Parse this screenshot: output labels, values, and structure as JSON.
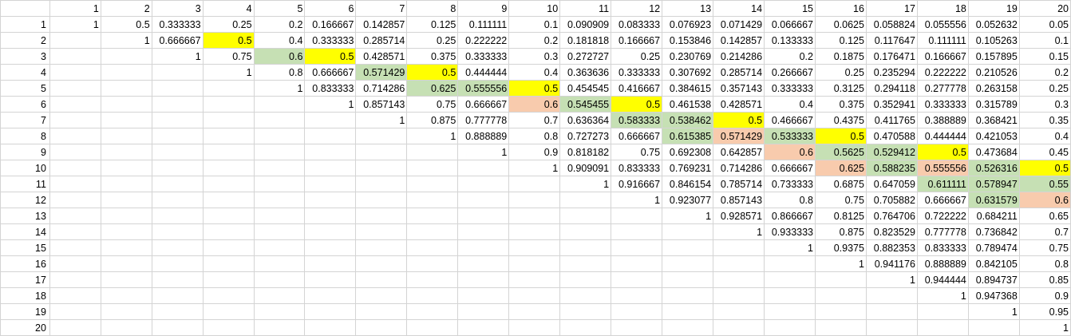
{
  "colors": {
    "yellow": "#ffff00",
    "green": "#c6e0b4",
    "orange": "#f8cbad",
    "grid": "#d4d4d4"
  },
  "column_headers": [
    "1",
    "2",
    "3",
    "4",
    "5",
    "6",
    "7",
    "8",
    "9",
    "10",
    "11",
    "12",
    "13",
    "14",
    "15",
    "16",
    "17",
    "18",
    "19",
    "20"
  ],
  "rows": [
    {
      "header": "1",
      "cells": [
        "1",
        "0.5",
        "0.333333",
        "0.25",
        "0.2",
        "0.166667",
        "0.142857",
        "0.125",
        "0.111111",
        "0.1",
        "0.090909",
        "0.083333",
        "0.076923",
        "0.071429",
        "0.066667",
        "0.0625",
        "0.058824",
        "0.055556",
        "0.052632",
        "0.05"
      ],
      "fills": [
        "",
        "",
        "",
        "",
        "",
        "",
        "",
        "",
        "",
        "",
        "",
        "",
        "",
        "",
        "",
        "",
        "",
        "",
        "",
        ""
      ]
    },
    {
      "header": "2",
      "cells": [
        "",
        "1",
        "0.666667",
        "0.5",
        "0.4",
        "0.333333",
        "0.285714",
        "0.25",
        "0.222222",
        "0.2",
        "0.181818",
        "0.166667",
        "0.153846",
        "0.142857",
        "0.133333",
        "0.125",
        "0.117647",
        "0.111111",
        "0.105263",
        "0.1"
      ],
      "fills": [
        "",
        "",
        "",
        "yellow",
        "",
        "",
        "",
        "",
        "",
        "",
        "",
        "",
        "",
        "",
        "",
        "",
        "",
        "",
        "",
        ""
      ]
    },
    {
      "header": "3",
      "cells": [
        "",
        "",
        "1",
        "0.75",
        "0.6",
        "0.5",
        "0.428571",
        "0.375",
        "0.333333",
        "0.3",
        "0.272727",
        "0.25",
        "0.230769",
        "0.214286",
        "0.2",
        "0.1875",
        "0.176471",
        "0.166667",
        "0.157895",
        "0.15"
      ],
      "fills": [
        "",
        "",
        "",
        "",
        "green",
        "yellow",
        "",
        "",
        "",
        "",
        "",
        "",
        "",
        "",
        "",
        "",
        "",
        "",
        "",
        ""
      ]
    },
    {
      "header": "4",
      "cells": [
        "",
        "",
        "",
        "1",
        "0.8",
        "0.666667",
        "0.571429",
        "0.5",
        "0.444444",
        "0.4",
        "0.363636",
        "0.333333",
        "0.307692",
        "0.285714",
        "0.266667",
        "0.25",
        "0.235294",
        "0.222222",
        "0.210526",
        "0.2"
      ],
      "fills": [
        "",
        "",
        "",
        "",
        "",
        "",
        "green",
        "yellow",
        "",
        "",
        "",
        "",
        "",
        "",
        "",
        "",
        "",
        "",
        "",
        ""
      ]
    },
    {
      "header": "5",
      "cells": [
        "",
        "",
        "",
        "",
        "1",
        "0.833333",
        "0.714286",
        "0.625",
        "0.555556",
        "0.5",
        "0.454545",
        "0.416667",
        "0.384615",
        "0.357143",
        "0.333333",
        "0.3125",
        "0.294118",
        "0.277778",
        "0.263158",
        "0.25"
      ],
      "fills": [
        "",
        "",
        "",
        "",
        "",
        "",
        "",
        "green",
        "green",
        "yellow",
        "",
        "",
        "",
        "",
        "",
        "",
        "",
        "",
        "",
        ""
      ]
    },
    {
      "header": "6",
      "cells": [
        "",
        "",
        "",
        "",
        "",
        "1",
        "0.857143",
        "0.75",
        "0.666667",
        "0.6",
        "0.545455",
        "0.5",
        "0.461538",
        "0.428571",
        "0.4",
        "0.375",
        "0.352941",
        "0.333333",
        "0.315789",
        "0.3"
      ],
      "fills": [
        "",
        "",
        "",
        "",
        "",
        "",
        "",
        "",
        "",
        "orange",
        "green",
        "yellow",
        "",
        "",
        "",
        "",
        "",
        "",
        "",
        ""
      ]
    },
    {
      "header": "7",
      "cells": [
        "",
        "",
        "",
        "",
        "",
        "",
        "1",
        "0.875",
        "0.777778",
        "0.7",
        "0.636364",
        "0.583333",
        "0.538462",
        "0.5",
        "0.466667",
        "0.4375",
        "0.411765",
        "0.388889",
        "0.368421",
        "0.35"
      ],
      "fills": [
        "",
        "",
        "",
        "",
        "",
        "",
        "",
        "",
        "",
        "",
        "",
        "green",
        "green",
        "yellow",
        "",
        "",
        "",
        "",
        "",
        ""
      ]
    },
    {
      "header": "8",
      "cells": [
        "",
        "",
        "",
        "",
        "",
        "",
        "",
        "1",
        "0.888889",
        "0.8",
        "0.727273",
        "0.666667",
        "0.615385",
        "0.571429",
        "0.533333",
        "0.5",
        "0.470588",
        "0.444444",
        "0.421053",
        "0.4"
      ],
      "fills": [
        "",
        "",
        "",
        "",
        "",
        "",
        "",
        "",
        "",
        "",
        "",
        "",
        "green",
        "orange",
        "green",
        "yellow",
        "",
        "",
        "",
        ""
      ]
    },
    {
      "header": "9",
      "cells": [
        "",
        "",
        "",
        "",
        "",
        "",
        "",
        "",
        "1",
        "0.9",
        "0.818182",
        "0.75",
        "0.692308",
        "0.642857",
        "0.6",
        "0.5625",
        "0.529412",
        "0.5",
        "0.473684",
        "0.45"
      ],
      "fills": [
        "",
        "",
        "",
        "",
        "",
        "",
        "",
        "",
        "",
        "",
        "",
        "",
        "",
        "",
        "orange",
        "green",
        "green",
        "yellow",
        "",
        ""
      ]
    },
    {
      "header": "10",
      "cells": [
        "",
        "",
        "",
        "",
        "",
        "",
        "",
        "",
        "",
        "1",
        "0.909091",
        "0.833333",
        "0.769231",
        "0.714286",
        "0.666667",
        "0.625",
        "0.588235",
        "0.555556",
        "0.526316",
        "0.5"
      ],
      "fills": [
        "",
        "",
        "",
        "",
        "",
        "",
        "",
        "",
        "",
        "",
        "",
        "",
        "",
        "",
        "",
        "orange",
        "green",
        "orange",
        "green",
        "yellow"
      ]
    },
    {
      "header": "11",
      "cells": [
        "",
        "",
        "",
        "",
        "",
        "",
        "",
        "",
        "",
        "",
        "1",
        "0.916667",
        "0.846154",
        "0.785714",
        "0.733333",
        "0.6875",
        "0.647059",
        "0.611111",
        "0.578947",
        "0.55"
      ],
      "fills": [
        "",
        "",
        "",
        "",
        "",
        "",
        "",
        "",
        "",
        "",
        "",
        "",
        "",
        "",
        "",
        "",
        "",
        "green",
        "green",
        "green"
      ]
    },
    {
      "header": "12",
      "cells": [
        "",
        "",
        "",
        "",
        "",
        "",
        "",
        "",
        "",
        "",
        "",
        "1",
        "0.923077",
        "0.857143",
        "0.8",
        "0.75",
        "0.705882",
        "0.666667",
        "0.631579",
        "0.6"
      ],
      "fills": [
        "",
        "",
        "",
        "",
        "",
        "",
        "",
        "",
        "",
        "",
        "",
        "",
        "",
        "",
        "",
        "",
        "",
        "",
        "green",
        "orange"
      ]
    },
    {
      "header": "13",
      "cells": [
        "",
        "",
        "",
        "",
        "",
        "",
        "",
        "",
        "",
        "",
        "",
        "",
        "1",
        "0.928571",
        "0.866667",
        "0.8125",
        "0.764706",
        "0.722222",
        "0.684211",
        "0.65"
      ],
      "fills": [
        "",
        "",
        "",
        "",
        "",
        "",
        "",
        "",
        "",
        "",
        "",
        "",
        "",
        "",
        "",
        "",
        "",
        "",
        "",
        ""
      ]
    },
    {
      "header": "14",
      "cells": [
        "",
        "",
        "",
        "",
        "",
        "",
        "",
        "",
        "",
        "",
        "",
        "",
        "",
        "1",
        "0.933333",
        "0.875",
        "0.823529",
        "0.777778",
        "0.736842",
        "0.7"
      ],
      "fills": [
        "",
        "",
        "",
        "",
        "",
        "",
        "",
        "",
        "",
        "",
        "",
        "",
        "",
        "",
        "",
        "",
        "",
        "",
        "",
        ""
      ]
    },
    {
      "header": "15",
      "cells": [
        "",
        "",
        "",
        "",
        "",
        "",
        "",
        "",
        "",
        "",
        "",
        "",
        "",
        "",
        "1",
        "0.9375",
        "0.882353",
        "0.833333",
        "0.789474",
        "0.75"
      ],
      "fills": [
        "",
        "",
        "",
        "",
        "",
        "",
        "",
        "",
        "",
        "",
        "",
        "",
        "",
        "",
        "",
        "",
        "",
        "",
        "",
        ""
      ]
    },
    {
      "header": "16",
      "cells": [
        "",
        "",
        "",
        "",
        "",
        "",
        "",
        "",
        "",
        "",
        "",
        "",
        "",
        "",
        "",
        "1",
        "0.941176",
        "0.888889",
        "0.842105",
        "0.8"
      ],
      "fills": [
        "",
        "",
        "",
        "",
        "",
        "",
        "",
        "",
        "",
        "",
        "",
        "",
        "",
        "",
        "",
        "",
        "",
        "",
        "",
        ""
      ]
    },
    {
      "header": "17",
      "cells": [
        "",
        "",
        "",
        "",
        "",
        "",
        "",
        "",
        "",
        "",
        "",
        "",
        "",
        "",
        "",
        "",
        "1",
        "0.944444",
        "0.894737",
        "0.85"
      ],
      "fills": [
        "",
        "",
        "",
        "",
        "",
        "",
        "",
        "",
        "",
        "",
        "",
        "",
        "",
        "",
        "",
        "",
        "",
        "",
        "",
        ""
      ]
    },
    {
      "header": "18",
      "cells": [
        "",
        "",
        "",
        "",
        "",
        "",
        "",
        "",
        "",
        "",
        "",
        "",
        "",
        "",
        "",
        "",
        "",
        "1",
        "0.947368",
        "0.9"
      ],
      "fills": [
        "",
        "",
        "",
        "",
        "",
        "",
        "",
        "",
        "",
        "",
        "",
        "",
        "",
        "",
        "",
        "",
        "",
        "",
        "",
        ""
      ]
    },
    {
      "header": "19",
      "cells": [
        "",
        "",
        "",
        "",
        "",
        "",
        "",
        "",
        "",
        "",
        "",
        "",
        "",
        "",
        "",
        "",
        "",
        "",
        "1",
        "0.95"
      ],
      "fills": [
        "",
        "",
        "",
        "",
        "",
        "",
        "",
        "",
        "",
        "",
        "",
        "",
        "",
        "",
        "",
        "",
        "",
        "",
        "",
        ""
      ]
    },
    {
      "header": "20",
      "cells": [
        "",
        "",
        "",
        "",
        "",
        "",
        "",
        "",
        "",
        "",
        "",
        "",
        "",
        "",
        "",
        "",
        "",
        "",
        "",
        "1"
      ],
      "fills": [
        "",
        "",
        "",
        "",
        "",
        "",
        "",
        "",
        "",
        "",
        "",
        "",
        "",
        "",
        "",
        "",
        "",
        "",
        "",
        ""
      ]
    }
  ]
}
